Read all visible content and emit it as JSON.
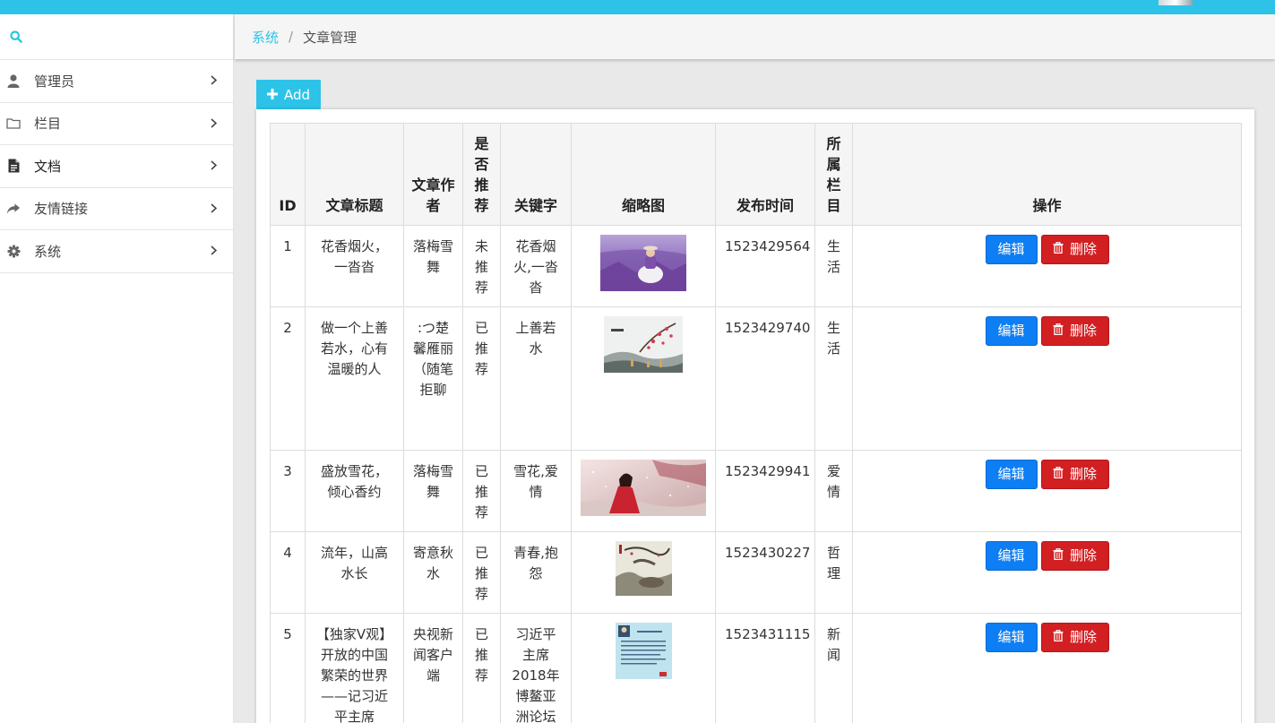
{
  "breadcrumb": {
    "root": "系统",
    "sep": "/",
    "current": "文章管理"
  },
  "sidebar": {
    "items": [
      {
        "label": "管理员",
        "icon": "user-icon"
      },
      {
        "label": "栏目",
        "icon": "folder-icon"
      },
      {
        "label": "文档",
        "icon": "file-icon"
      },
      {
        "label": "友情链接",
        "icon": "share-icon"
      },
      {
        "label": "系统",
        "icon": "gear-icon"
      }
    ]
  },
  "toolbar": {
    "add_label": "Add"
  },
  "table": {
    "headers": {
      "id": "ID",
      "title": "文章标题",
      "author": "文章作者",
      "recommend": "是否推荐",
      "keywords": "关键字",
      "thumb": "缩略图",
      "time": "发布时间",
      "category": "所属栏目",
      "ops": "操作"
    },
    "edit_label": "编辑",
    "delete_label": "删除",
    "rows": [
      {
        "id": "1",
        "title": "花香烟火，一沓沓",
        "author": "落梅雪舞",
        "recommend": "未推荐",
        "keywords": "花香烟火,一沓沓",
        "time": "1523429564",
        "category": "生活",
        "thumb": "lavender-field"
      },
      {
        "id": "2",
        "title": "做一个上善若水，心有温暖的人",
        "author": ":つ楚馨雁丽（随笔拒聊",
        "recommend": "已推荐",
        "keywords": "上善若水",
        "time": "1523429740",
        "category": "生活",
        "thumb": "ink-plum-painting"
      },
      {
        "id": "3",
        "title": "盛放雪花，倾心香约",
        "author": "落梅雪舞",
        "recommend": "已推荐",
        "keywords": "雪花,爱情",
        "time": "1523429941",
        "category": "爱情",
        "thumb": "girl-in-snow"
      },
      {
        "id": "4",
        "title": "流年，山高水长",
        "author": "寄意秋水",
        "recommend": "已推荐",
        "keywords": "青春,抱怨",
        "time": "1523430227",
        "category": "哲理",
        "thumb": "ink-landscape"
      },
      {
        "id": "5",
        "title": "【独家V观】开放的中国 繁荣的世界——记习近平主席",
        "author": "央视新闻客户端",
        "recommend": "已推荐",
        "keywords": "习近平主席2018年博鳌亚洲论坛",
        "time": "1523431115",
        "category": "新闻",
        "thumb": "news-document"
      }
    ]
  }
}
